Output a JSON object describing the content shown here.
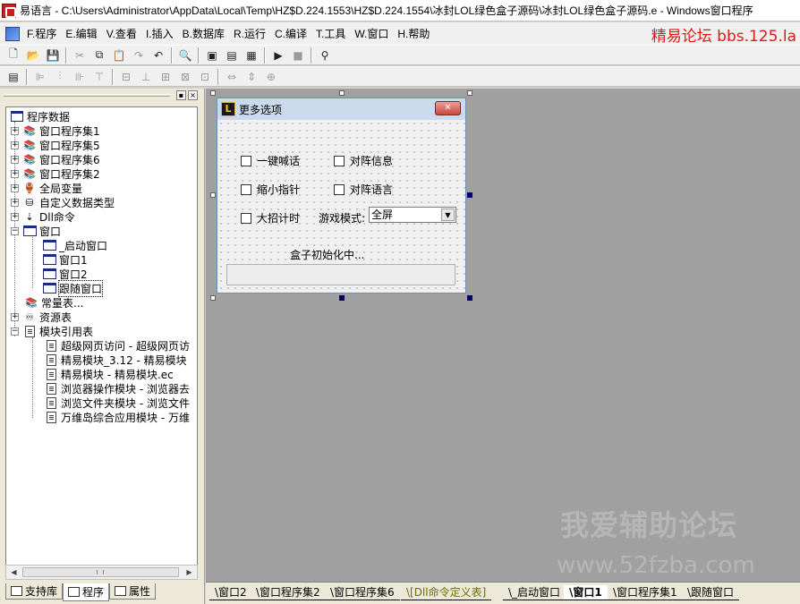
{
  "window": {
    "title": "易语言 - C:\\Users\\Administrator\\AppData\\Local\\Temp\\HZ$D.224.1553\\HZ$D.224.1554\\冰封LOL绿色盒子源码\\冰封LOL绿色盒子源码.e - Windows窗口程序"
  },
  "menubar": {
    "items": [
      "F.程序",
      "E.编辑",
      "V.查看",
      "I.插入",
      "B.数据库",
      "R.运行",
      "C.编译",
      "T.工具",
      "W.窗口",
      "H.帮助"
    ],
    "brand": "精易论坛 bbs.125.la"
  },
  "toolbar1": {
    "icons": [
      "new-file-icon",
      "open-folder-icon",
      "save-icon",
      "cut-icon",
      "copy-icon",
      "paste-icon",
      "redo-icon",
      "undo-icon",
      "find-icon",
      "layout-icon",
      "layout-icon-2",
      "layout-icon-3",
      "run-icon",
      "stop-icon",
      "binoculars-icon"
    ]
  },
  "panel": {
    "tree": [
      {
        "label": "程序数据",
        "level": 0
      },
      {
        "label": "窗口程序集1",
        "level": 1
      },
      {
        "label": "窗口程序集5",
        "level": 1
      },
      {
        "label": "窗口程序集6",
        "level": 1
      },
      {
        "label": "窗口程序集2",
        "level": 1
      },
      {
        "label": "全局变量",
        "level": 1
      },
      {
        "label": "自定义数据类型",
        "level": 1
      },
      {
        "label": "Dll命令",
        "level": 1
      },
      {
        "label": "窗口",
        "level": 1
      },
      {
        "label": "_启动窗口",
        "level": 2
      },
      {
        "label": "窗口1",
        "level": 2
      },
      {
        "label": "窗口2",
        "level": 2
      },
      {
        "label": "跟随窗口",
        "level": 2
      },
      {
        "label": "常量表...",
        "level": 1
      },
      {
        "label": "资源表",
        "level": 1
      },
      {
        "label": "模块引用表",
        "level": 1
      },
      {
        "label": "超级网页访问 - 超级网页访",
        "level": 2
      },
      {
        "label": "精易模块_3.12 - 精易模块",
        "level": 2
      },
      {
        "label": "精易模块 - 精易模块.ec",
        "level": 2
      },
      {
        "label": "浏览器操作模块 - 浏览器去",
        "level": 2
      },
      {
        "label": "浏览文件夹模块 - 浏览文件",
        "level": 2
      },
      {
        "label": "万维岛综合应用模块 - 万维",
        "level": 2
      }
    ],
    "tabs": [
      "支持库",
      "程序",
      "属性"
    ]
  },
  "form": {
    "title": "更多选项",
    "options": [
      "一键喊话",
      "对阵信息",
      "缩小指针",
      "对阵语言",
      "大招计时"
    ],
    "mode_label": "游戏模式:",
    "mode_value": "全屏",
    "status": "盒子初始化中..."
  },
  "watermark": {
    "line1": "我爱辅助论坛",
    "line2": "www.52fzba.com"
  },
  "bottom_tabs": [
    "窗口2",
    "窗口程序集2",
    "窗口程序集6",
    "[Dll命令定义表]",
    "_启动窗口",
    "窗口1",
    "窗口程序集1",
    "跟随窗口"
  ]
}
